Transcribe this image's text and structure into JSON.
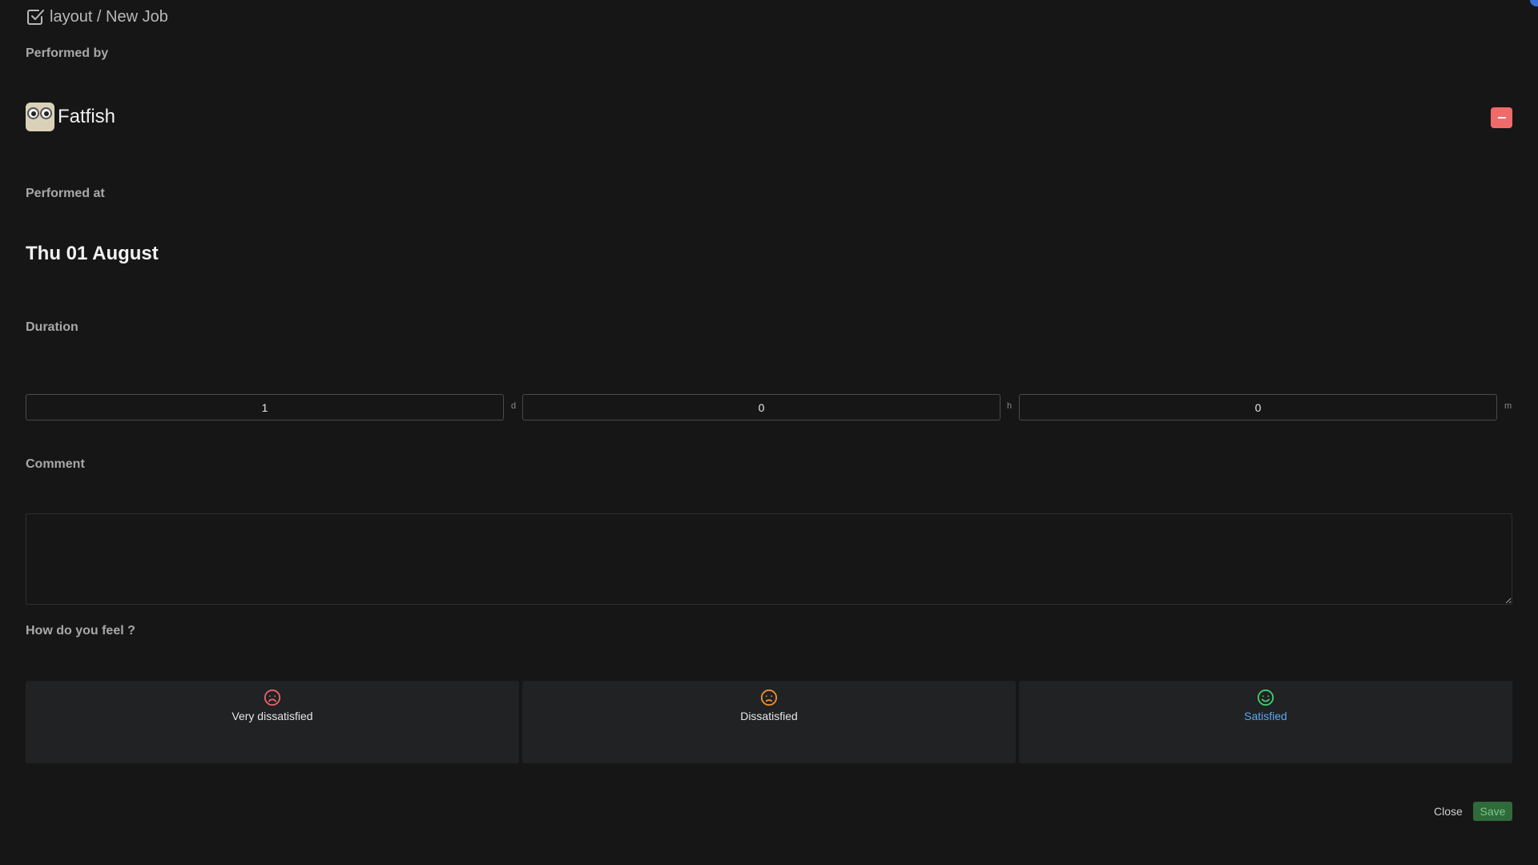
{
  "header": {
    "title": "layout / New Job",
    "icon": "checkbox-icon"
  },
  "performed_by": {
    "label": "Performed by",
    "name": "Fatfish",
    "avatar": "owl-avatar",
    "remove_icon": "minus-icon"
  },
  "performed_at": {
    "label": "Performed at",
    "date": "Thu 01 August"
  },
  "duration": {
    "label": "Duration",
    "days": "1",
    "days_unit": "d",
    "hours": "0",
    "hours_unit": "h",
    "minutes": "0",
    "minutes_unit": "m"
  },
  "comment": {
    "label": "Comment",
    "value": ""
  },
  "feeling": {
    "label": "How do you feel ?",
    "options": [
      {
        "label": "Very dissatisfied",
        "icon": "very-dissatisfied-icon",
        "color": "#e8636b",
        "selected": false
      },
      {
        "label": "Dissatisfied",
        "icon": "dissatisfied-icon",
        "color": "#f0902e",
        "selected": false
      },
      {
        "label": "Satisfied",
        "icon": "satisfied-icon",
        "color": "#3ecf6e",
        "selected": true
      }
    ]
  },
  "actions": {
    "close_label": "Close",
    "save_label": "Save"
  },
  "colors": {
    "background": "#161616",
    "danger": "#f06a6a",
    "save": "#2f6b3a",
    "selected_text": "#5aa9f0"
  }
}
